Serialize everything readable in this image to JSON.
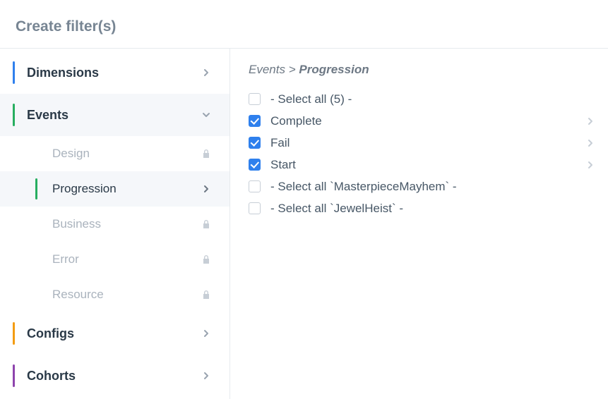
{
  "title": "Create filter(s)",
  "sidebar": {
    "categories": [
      {
        "label": "Dimensions",
        "accent": "#2f80ed",
        "expanded": false
      },
      {
        "label": "Events",
        "accent": "#27ae60",
        "expanded": true
      },
      {
        "label": "Configs",
        "accent": "#f39c12",
        "expanded": false
      },
      {
        "label": "Cohorts",
        "accent": "#8e44ad",
        "expanded": false
      }
    ],
    "eventsSubitems": [
      {
        "label": "Design",
        "locked": true,
        "active": false
      },
      {
        "label": "Progression",
        "locked": false,
        "active": true
      },
      {
        "label": "Business",
        "locked": true,
        "active": false
      },
      {
        "label": "Error",
        "locked": true,
        "active": false
      },
      {
        "label": "Resource",
        "locked": true,
        "active": false
      }
    ]
  },
  "breadcrumb": {
    "root": "Events",
    "sep": ">",
    "current": "Progression"
  },
  "options": [
    {
      "label": "- Select all (5) -",
      "checked": false,
      "hasArrow": false
    },
    {
      "label": "Complete",
      "checked": true,
      "hasArrow": true
    },
    {
      "label": "Fail",
      "checked": true,
      "hasArrow": true
    },
    {
      "label": "Start",
      "checked": true,
      "hasArrow": true
    },
    {
      "label": "- Select all `MasterpieceMayhem` -",
      "checked": false,
      "hasArrow": false
    },
    {
      "label": "- Select all `JewelHeist` -",
      "checked": false,
      "hasArrow": false
    }
  ]
}
